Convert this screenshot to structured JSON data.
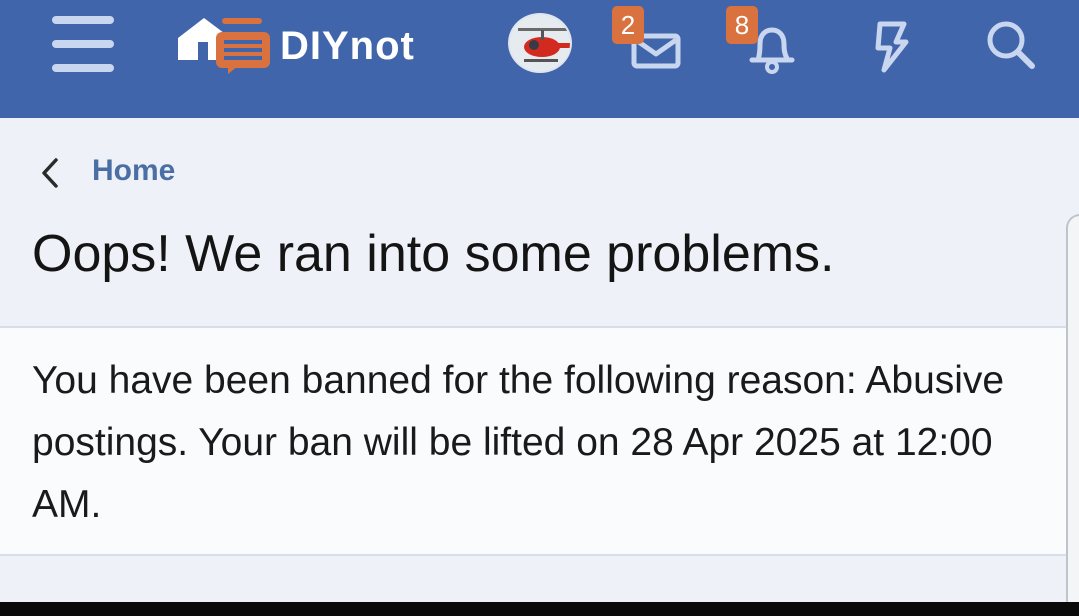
{
  "header": {
    "brand": "DIYnot",
    "messages_count": "2",
    "notifications_count": "8",
    "bg_color": "#4165aa",
    "badge_color": "#d9723e"
  },
  "breadcrumb": {
    "label": "Home",
    "icon": "chevron-left-icon"
  },
  "page": {
    "title": "Oops! We ran into some problems.",
    "notice": "You have been banned for the following reason: Abusive postings. Your ban will be lifted on 28 Apr 2025 at 12:00 AM."
  },
  "icons": [
    "menu-icon",
    "logo-icon",
    "avatar",
    "mail-icon",
    "bell-icon",
    "bolt-icon",
    "search-icon"
  ]
}
